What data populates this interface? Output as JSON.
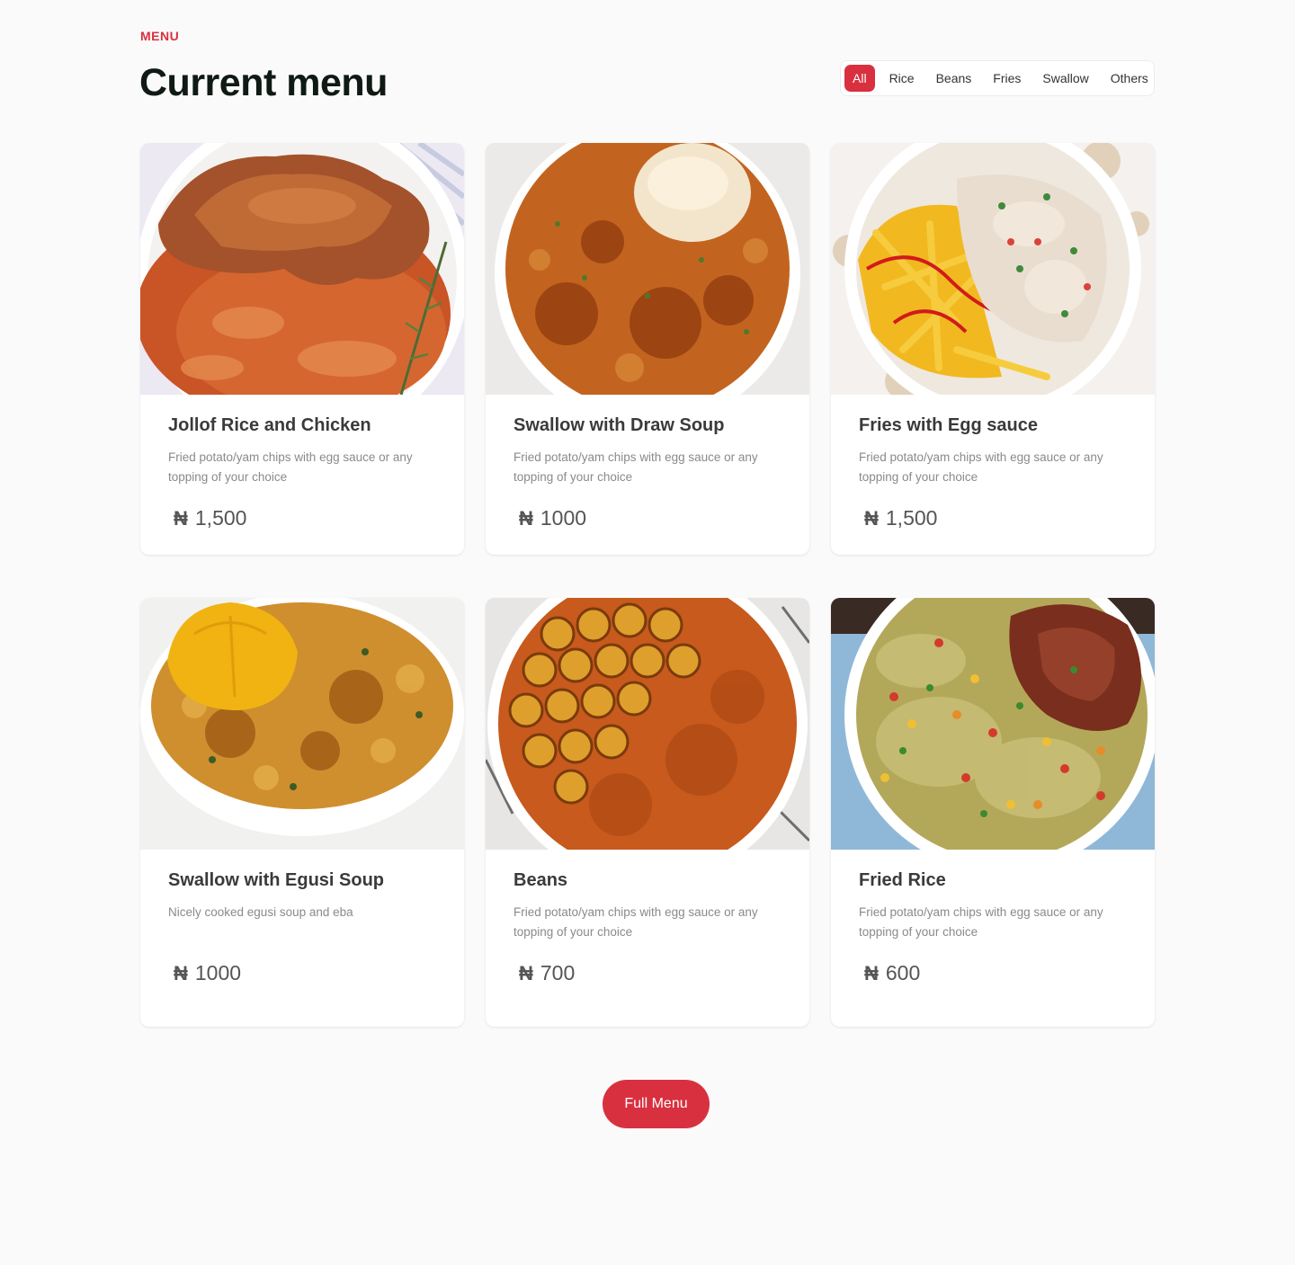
{
  "header": {
    "eyebrow": "MENU",
    "title": "Current menu"
  },
  "filters": [
    {
      "label": "All",
      "active": true
    },
    {
      "label": "Rice",
      "active": false
    },
    {
      "label": "Beans",
      "active": false
    },
    {
      "label": "Fries",
      "active": false
    },
    {
      "label": "Swallow",
      "active": false
    },
    {
      "label": "Others",
      "active": false
    }
  ],
  "currency_symbol": "₦",
  "items": [
    {
      "title": "Jollof Rice and Chicken",
      "description": "Fried potato/yam chips with egg sauce or any topping of your choice",
      "price": "1,500",
      "image": "jollof-rice-chicken-photo"
    },
    {
      "title": "Swallow with Draw Soup",
      "description": "Fried potato/yam chips with egg sauce or any topping of your choice",
      "price": "1000",
      "image": "draw-soup-photo"
    },
    {
      "title": "Fries with Egg sauce",
      "description": "Fried potato/yam chips with egg sauce or any topping of your choice",
      "price": "1,500",
      "image": "fries-egg-sauce-photo"
    },
    {
      "title": "Swallow with Egusi Soup",
      "description": "Nicely cooked egusi soup and eba",
      "price": "1000",
      "image": "egusi-soup-photo"
    },
    {
      "title": "Beans",
      "description": "Fried potato/yam chips with egg sauce or any topping of your choice",
      "price": "700",
      "image": "beans-plantain-photo"
    },
    {
      "title": "Fried Rice",
      "description": "Fried potato/yam chips with egg sauce or any topping of your choice",
      "price": "600",
      "image": "fried-rice-photo"
    }
  ],
  "cta": {
    "label": "Full Menu"
  },
  "colors": {
    "accent": "#d9303f",
    "background": "#fafafa",
    "card": "#ffffff"
  }
}
